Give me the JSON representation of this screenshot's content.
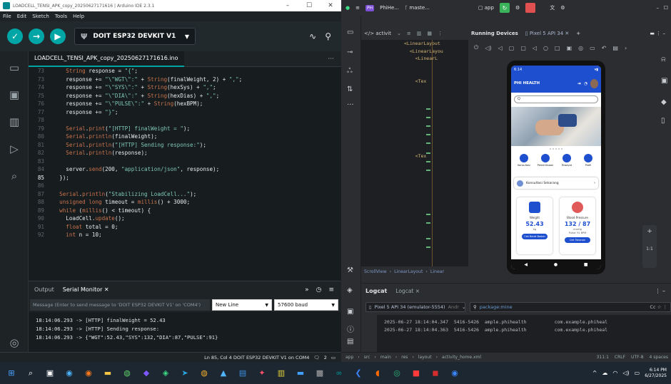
{
  "arduino": {
    "window_title": "LOADCELL_TENSI_APK_copy_20250627171616 | Arduino IDE 2.3.1",
    "menu": [
      "File",
      "Edit",
      "Sketch",
      "Tools",
      "Help"
    ],
    "board": "DOIT ESP32 DEVKIT V1",
    "file_tab": "LOADCELL_TENSI_APK_copy_20250627171616.ino",
    "code_lines": [
      {
        "n": "73",
        "html": "    <span class='k'>String</span> response = <span class='s'>\"{\"</span>;"
      },
      {
        "n": "73",
        "html": "    response += <span class='s'>\"\\\"WGT\\\":\"</span> + <span class='k'>String</span>(finalWeight, 2) + <span class='s'>\",\"</span>;"
      },
      {
        "n": "74",
        "html": "    response += <span class='s'>\"\\\"SYS\\\":\"</span> + <span class='k'>String</span>(hexSys) + <span class='s'>\",\"</span>;"
      },
      {
        "n": "75",
        "html": "    response += <span class='s'>\"\\\"DIA\\\":\"</span> + <span class='k'>String</span>(hexDias) + <span class='s'>\",\"</span>;"
      },
      {
        "n": "76",
        "html": "    response += <span class='s'>\"\\\"PULSE\\\":\"</span> + <span class='k'>String</span>(hexBPM);"
      },
      {
        "n": "77",
        "html": "    response += <span class='s'>\"}\"</span>;"
      },
      {
        "n": "78",
        "html": ""
      },
      {
        "n": "79",
        "html": "    <span class='f'>Serial</span>.<span class='f'>print</span>(<span class='s'>\"[HTTP] finalWeight = \"</span>);"
      },
      {
        "n": "80",
        "html": "    <span class='f'>Serial</span>.<span class='f'>println</span>(finalWeight);"
      },
      {
        "n": "81",
        "html": "    <span class='f'>Serial</span>.<span class='f'>println</span>(<span class='s'>\"[HTTP] Sending response:\"</span>);"
      },
      {
        "n": "82",
        "html": "    <span class='f'>Serial</span>.<span class='f'>println</span>(response);"
      },
      {
        "n": "83",
        "html": ""
      },
      {
        "n": "84",
        "html": "    server.<span class='f'>send</span>(200, <span class='s'>\"application/json\"</span>, response);"
      },
      {
        "n": "85",
        "html": "  });",
        "cur": true
      },
      {
        "n": "86",
        "html": ""
      },
      {
        "n": "87",
        "html": "  <span class='f'>Serial</span>.<span class='f'>println</span>(<span class='s'>\"Stabilizing LoadCell...\"</span>);"
      },
      {
        "n": "88",
        "html": "  <span class='k'>unsigned long</span> timeout = <span class='f'>millis</span>() + 3000;"
      },
      {
        "n": "89",
        "html": "  <span class='k'>while</span> (<span class='f'>millis</span>() &lt; timeout) {"
      },
      {
        "n": "90",
        "html": "    LoadCell.<span class='f'>update</span>();"
      },
      {
        "n": "91",
        "html": "    <span class='k'>float</span> total = 0;"
      },
      {
        "n": "92",
        "html": "    <span class='k'>int</span> n = 10;"
      }
    ],
    "output_tab": "Output",
    "serial_tab": "Serial Monitor",
    "message_placeholder": "Message (Enter to send message to 'DOIT ESP32 DEVKIT V1' on 'COM4')",
    "line_ending": "New Line",
    "baud": "57600 baud",
    "serial_lines": [
      "18:14:06.293 -> [HTTP] finalWeight = 52.43",
      "18:14:06.293 -> [HTTP] Sending response:",
      "18:14:06.293 -> {\"WGT\":52.43,\"SYS\":132,\"DIA\":87,\"PULSE\":91}"
    ],
    "status": "Ln 85, Col 4   DOIT ESP32 DEVKIT V1 on COM4",
    "status_count": "2"
  },
  "studio": {
    "project": "PhiHe...",
    "branch": "maste...",
    "module": "app",
    "file_tab": "activit",
    "device_tab_title": "Running Devices",
    "device_name": "Pixel 5 API 34",
    "xml_lines": [
      {
        "n": "",
        "t": "<LinearLayout"
      },
      {
        "n": "",
        "t": "  <LinearLayou"
      },
      {
        "n": "",
        "t": "    <LinearL"
      },
      {
        "n": "",
        "t": ""
      },
      {
        "n": "",
        "t": ""
      },
      {
        "n": "",
        "t": "    <Tex"
      },
      {
        "n": "",
        "t": ""
      },
      {
        "n": "",
        "t": ""
      },
      {
        "n": "",
        "t": ""
      },
      {
        "n": "",
        "t": ""
      },
      {
        "n": "",
        "t": ""
      },
      {
        "n": "",
        "t": ""
      },
      {
        "n": "",
        "t": ""
      },
      {
        "n": "",
        "t": ""
      },
      {
        "n": "",
        "t": ""
      },
      {
        "n": "",
        "t": "    <Tex"
      }
    ],
    "breadcrumb": [
      "ScrollView",
      "LinearLayout",
      "Linear"
    ],
    "logcat_title": "Logcat",
    "logcat_subtab": "Logcat",
    "log_device": "Pixel 5 API 34 (emulator-5554)",
    "log_device_suffix": "Andr",
    "log_filter": "package:mine",
    "log_filter_opts": "Cc",
    "log_lines": [
      "2025-06-27 18:14:04.347  5416-5426  ample.phihealth          com.example.phiheal",
      "2025-06-27 18:14:04.363  5416-5426  ample.phihealth          com.example.phiheal"
    ],
    "status_path": [
      "app",
      "src",
      "main",
      "res",
      "layout",
      "activity_home.xml"
    ],
    "status_right": [
      "311:1",
      "CRLF",
      "UTF-8",
      "4 spaces"
    ]
  },
  "app": {
    "time": "6:14",
    "title": "PHI HEALTH",
    "search_placeholder": "Q",
    "menu_labels": [
      "Konsultasi",
      "Pemeriksaan",
      "Riwayat",
      "Profil"
    ],
    "consult_label": "Konsultasi Sekarang",
    "weight_label": "Weight",
    "weight_value": "52.43",
    "weight_unit": "kg",
    "weight_btn": "Cek Berat Badan",
    "bp_label": "Blood Pressure",
    "bp_value": "132 / 87",
    "bp_unit": "mmHg",
    "pulse": "Pulse: 91 BPM",
    "bp_btn": "Cek Tekanan"
  },
  "taskbar": {
    "time": "6:14 PM",
    "date": "6/27/2025"
  }
}
